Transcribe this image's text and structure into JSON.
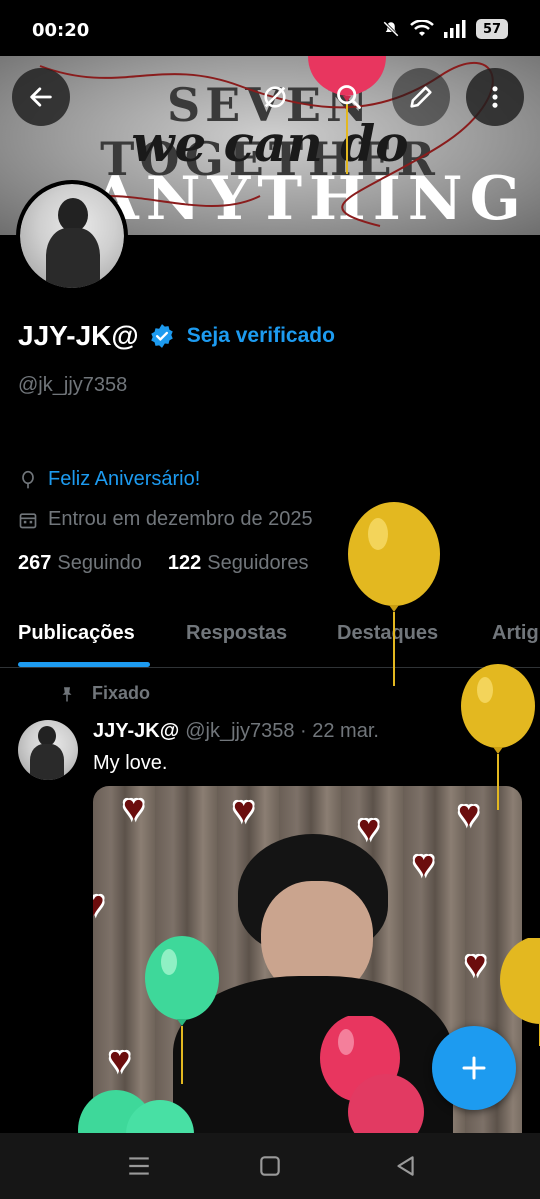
{
  "status_bar": {
    "time": "00:20",
    "battery": "57"
  },
  "banner": {
    "line1": "SEVEN TOGETHER",
    "line2": "we can do",
    "line3": "ANYTHING"
  },
  "header_buttons": [
    "back-arrow-icon",
    "grok-icon",
    "search-icon",
    "edit-icon",
    "more-vertical-icon"
  ],
  "profile": {
    "display_name": "JJY-JK@",
    "get_verified": "Seja verificado",
    "handle": "@jk_jjy7358",
    "birthday": "Feliz Aniversário!",
    "joined": "Entrou em dezembro de 2025",
    "following_count": "267",
    "following_label": "Seguindo",
    "followers_count": "122",
    "followers_label": "Seguidores"
  },
  "tabs": [
    {
      "label": "Publicações",
      "active": true
    },
    {
      "label": "Respostas",
      "active": false
    },
    {
      "label": "Destaques",
      "active": false
    },
    {
      "label": "Artig",
      "active": false
    }
  ],
  "pinned_post": {
    "pinned_label": "Fixado",
    "author": "JJY-JK@",
    "handle_date": "@jk_jjy7358 · 22 mar.",
    "text": "My love."
  },
  "colors": {
    "accent": "#1d9bf0",
    "background": "#000000",
    "muted_text": "#71767b",
    "balloon_red": "#e8365f",
    "balloon_yellow": "#e3b820",
    "balloon_green": "#3ed89a"
  },
  "fab": {
    "icon": "plus-icon"
  },
  "nav_bar": [
    "recents-icon",
    "home-icon",
    "back-icon"
  ]
}
